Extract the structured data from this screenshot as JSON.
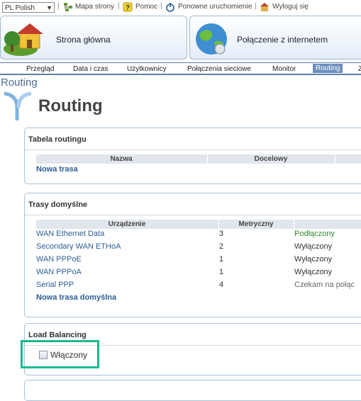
{
  "topbar": {
    "language": "PL Polish",
    "links": {
      "sitemap": "Mapa strony",
      "help": "Pomoc",
      "restart": "Ponowne uruchomienie",
      "logout": "Wyloguj się"
    }
  },
  "bigbuttons": {
    "home": "Strona główna",
    "internet": "Połączenie z internetem"
  },
  "tabs": [
    "Przegląd",
    "Data i czas",
    "Użytkownicy",
    "Połączenia sieciowe",
    "Monitor",
    "Routing",
    "Z"
  ],
  "active_tab": "Routing",
  "breadcrumb": "Routing",
  "page_title": "Routing",
  "routing_table": {
    "title": "Tabela routingu",
    "columns": [
      "Nazwa",
      "Docelowy"
    ],
    "add_link": "Nowa trasa"
  },
  "default_routes": {
    "title": "Trasy domyślne",
    "columns": [
      "Urządzenie",
      "Metryczny"
    ],
    "rows": [
      {
        "device": "WAN Ethernet Data",
        "metric": "3",
        "status": "Podłączony"
      },
      {
        "device": "Secondary WAN ETHoA",
        "metric": "2",
        "status": "Wyłączony"
      },
      {
        "device": "WAN PPPoE",
        "metric": "1",
        "status": "Wyłączony"
      },
      {
        "device": "WAN PPPoA",
        "metric": "1",
        "status": "Wyłączony"
      },
      {
        "device": "Serial PPP",
        "metric": "4",
        "status": "Czekam na połąc"
      }
    ],
    "add_link": "Nowa trasa domyślna"
  },
  "load_balancing": {
    "title": "Load Balancing",
    "checkbox_label": "Włączony",
    "checked": false
  },
  "colors": {
    "accent": "#6c8ebd",
    "link": "#2a5e95",
    "connected": "#2e8a2e",
    "highlight": "#19b98f"
  }
}
